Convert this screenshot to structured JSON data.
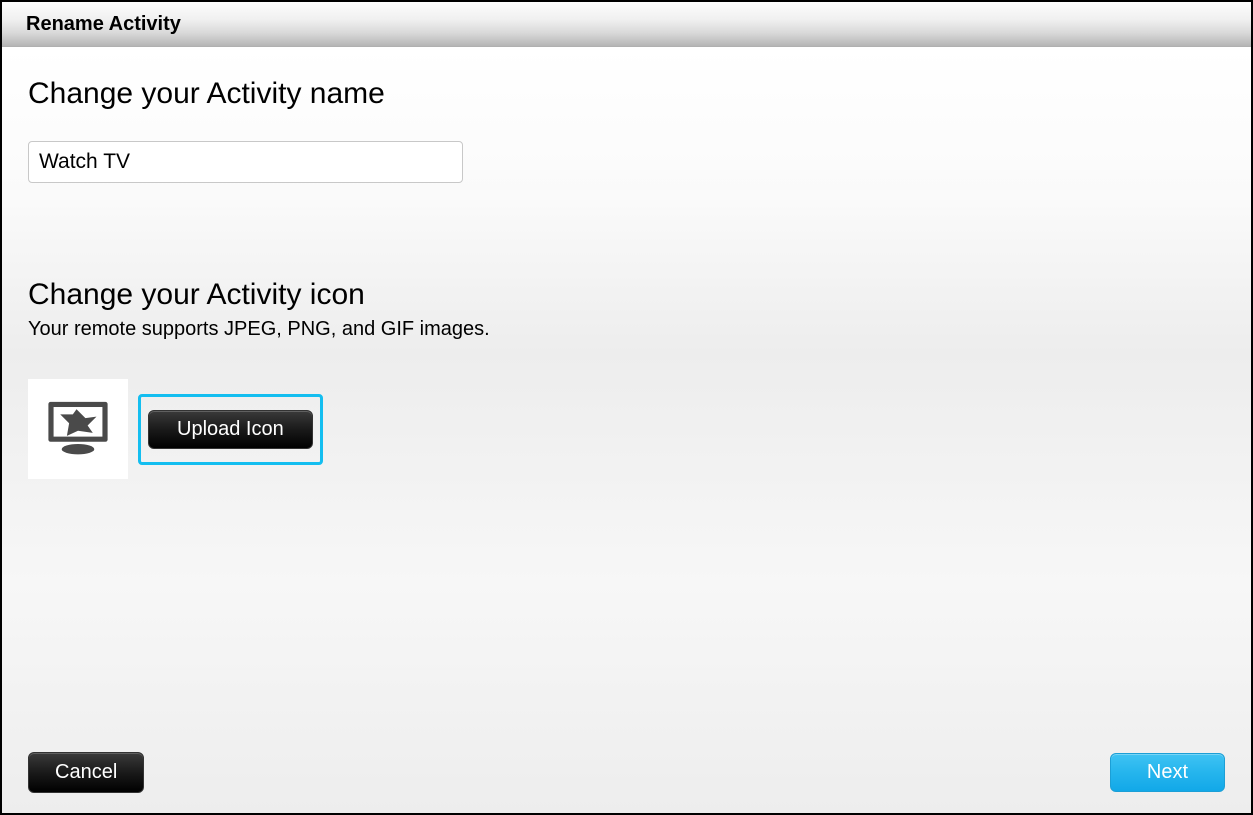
{
  "titleBar": {
    "title": "Rename Activity"
  },
  "sections": {
    "name": {
      "heading": "Change your Activity name",
      "value": "Watch TV"
    },
    "icon": {
      "heading": "Change your Activity icon",
      "sub": "Your remote supports JPEG, PNG, and GIF images.",
      "uploadLabel": "Upload Icon"
    }
  },
  "footer": {
    "cancel": "Cancel",
    "next": "Next"
  }
}
